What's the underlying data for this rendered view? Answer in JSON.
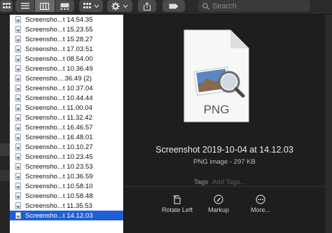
{
  "search": {
    "placeholder": "Search"
  },
  "files": [
    "Screensho...t 14.54.35",
    "Screensho...t 15.23.55",
    "Screensho...t 15.28.27",
    "Screensho...t 17.03.51",
    "Screensho...t 08.54.00",
    "Screensho...t 10.36.49",
    "Screensho....36.49 (2)",
    "Screensho...t 10.37.04",
    "Screensho...t 10.44.44",
    "Screensho...t 11.00.04",
    "Screensho...t 11.32.42",
    "Screensho...t 16.46.57",
    "Screensho...t 16.48.01",
    "Screensho...t 10.10.27",
    "Screensho...t 10.23.45",
    "Screensho...t 10.23.53",
    "Screensho...t 10.36.59",
    "Screensho...t 10.58.10",
    "Screensho...t 10.58.48",
    "Screensho...t 11.35.53",
    "Screensho...t 14.12.03"
  ],
  "selected_index": 20,
  "preview": {
    "file_type_label": "PNG",
    "filename": "Screenshot 2019-10-04 at 14.12.03",
    "info": "PNG image - 297 KB",
    "tags_label": "Tags",
    "tags_placeholder": "Add Tags...",
    "actions": [
      "Rotate Left",
      "Markup",
      "More..."
    ]
  },
  "colors": {
    "selection": "#1f5fd6",
    "toolbar": "#2a2a2a",
    "background": "#1e1e1e"
  }
}
